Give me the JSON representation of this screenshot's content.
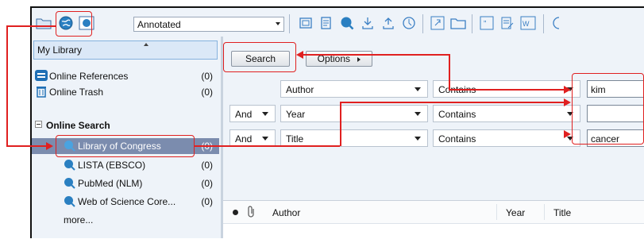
{
  "toolbar": {
    "style_select": "Annotated",
    "icons": [
      "local-library-mode-icon",
      "online-search-mode-icon",
      "integrated-library-mode-icon",
      "new-group-icon",
      "new-reference-icon",
      "online-search-icon",
      "import-icon",
      "export-icon",
      "find-full-text-icon",
      "open-link-icon",
      "open-file-icon",
      "insert-citation-icon",
      "format-bibliography-icon",
      "word-icon"
    ]
  },
  "sidebar": {
    "my_library": "My Library",
    "items": [
      {
        "label": "Online References",
        "count": "(0)"
      },
      {
        "label": "Online Trash",
        "count": "(0)"
      }
    ],
    "online_search_header": "Online Search",
    "search_items": [
      {
        "label": "Library of Congress",
        "count": "(0)"
      },
      {
        "label": "LISTA (EBSCO)",
        "count": "(0)"
      },
      {
        "label": "PubMed (NLM)",
        "count": "(0)"
      },
      {
        "label": "Web of Science Core...",
        "count": "(0)"
      }
    ],
    "more": "more..."
  },
  "search_panel": {
    "search_button": "Search",
    "options_button": "Options",
    "rows": [
      {
        "bool": "",
        "field": "Author",
        "op": "Contains",
        "value": "kim"
      },
      {
        "bool": "And",
        "field": "Year",
        "op": "Contains",
        "value": ""
      },
      {
        "bool": "And",
        "field": "Title",
        "op": "Contains",
        "value": "cancer"
      }
    ]
  },
  "results": {
    "columns": [
      "Author",
      "Year",
      "Title"
    ]
  },
  "colors": {
    "annotation": "#e02020",
    "selection": "#7b8cae",
    "icon_blue": "#2a7fc1"
  }
}
